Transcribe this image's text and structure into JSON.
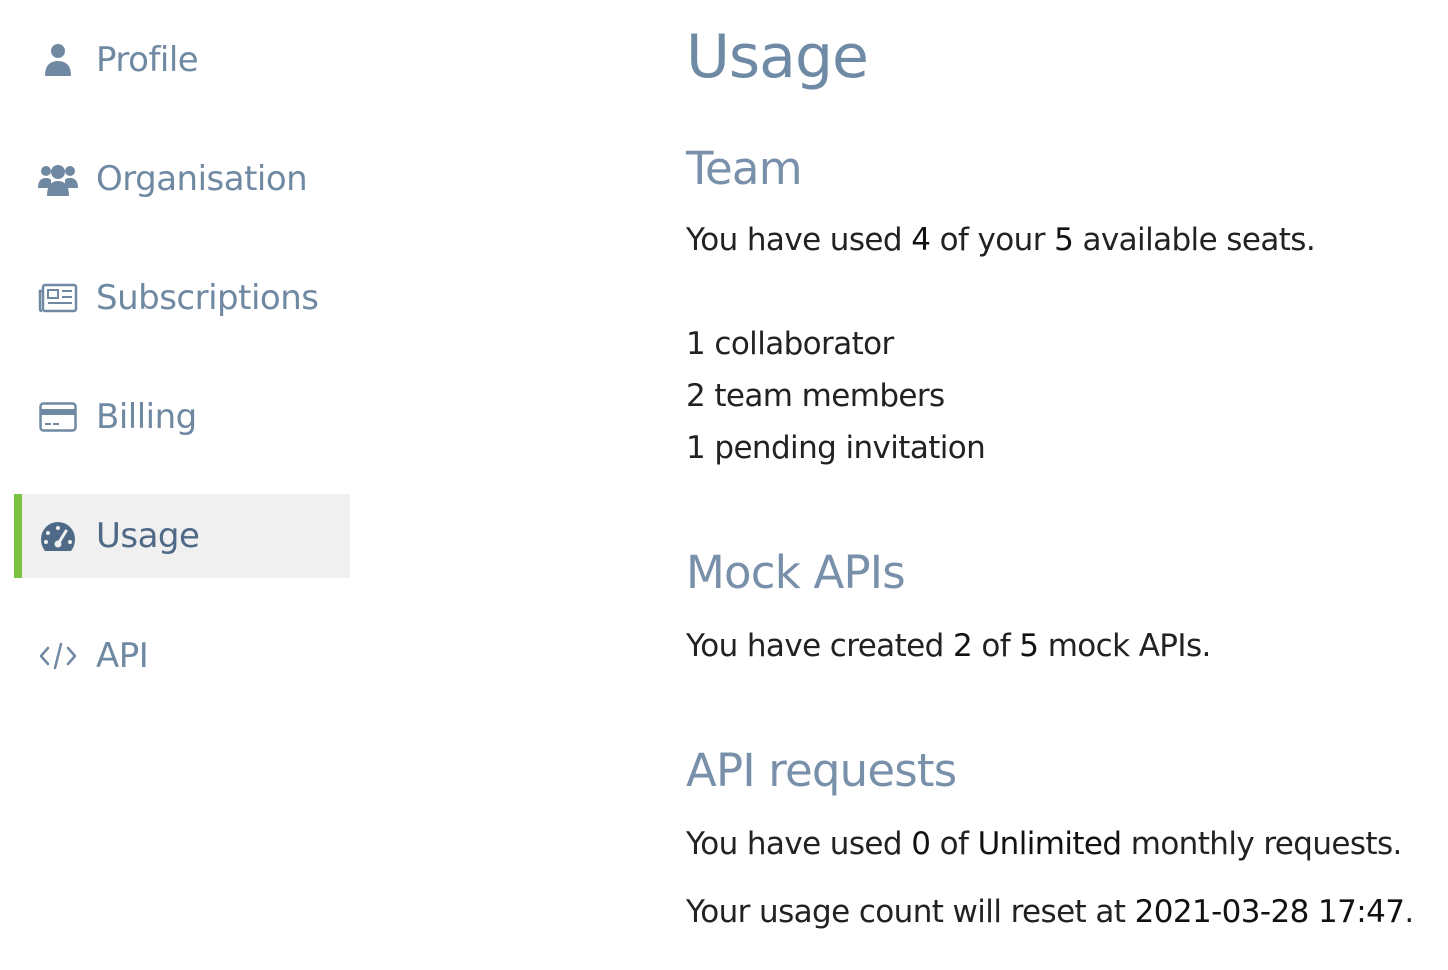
{
  "sidebar": {
    "items": [
      {
        "label": "Profile",
        "icon": "user-icon"
      },
      {
        "label": "Organisation",
        "icon": "users-icon"
      },
      {
        "label": "Subscriptions",
        "icon": "newspaper-icon"
      },
      {
        "label": "Billing",
        "icon": "credit-card-icon"
      },
      {
        "label": "Usage",
        "icon": "gauge-icon",
        "active": true
      },
      {
        "label": "API",
        "icon": "code-icon"
      }
    ],
    "active_accent": "#7cc242"
  },
  "main": {
    "title": "Usage",
    "team": {
      "heading": "Team",
      "seats_prefix": "You have used",
      "seats_used": "4",
      "seats_mid": "of your",
      "seats_total": "5",
      "seats_suffix": "available seats.",
      "collaborators": "1 collaborator",
      "team_members": "2 team members",
      "pending": "1 pending invitation"
    },
    "mock_apis": {
      "heading": "Mock APIs",
      "prefix": "You have created",
      "created": "2",
      "mid": "of",
      "total": "5",
      "suffix": "mock APIs."
    },
    "api_requests": {
      "heading": "API requests",
      "prefix": "You have used",
      "used": "0",
      "mid": "of",
      "limit": "Unlimited",
      "suffix": "monthly requests.",
      "reset_prefix": "Your usage count will reset at",
      "reset_time": "2021-03-28 17:47",
      "reset_suffix": "."
    }
  },
  "colors": {
    "heading": "#6f8aa5",
    "nav_text": "#7089a3",
    "active_bg": "#f0f0f0",
    "body_text": "#222222"
  }
}
